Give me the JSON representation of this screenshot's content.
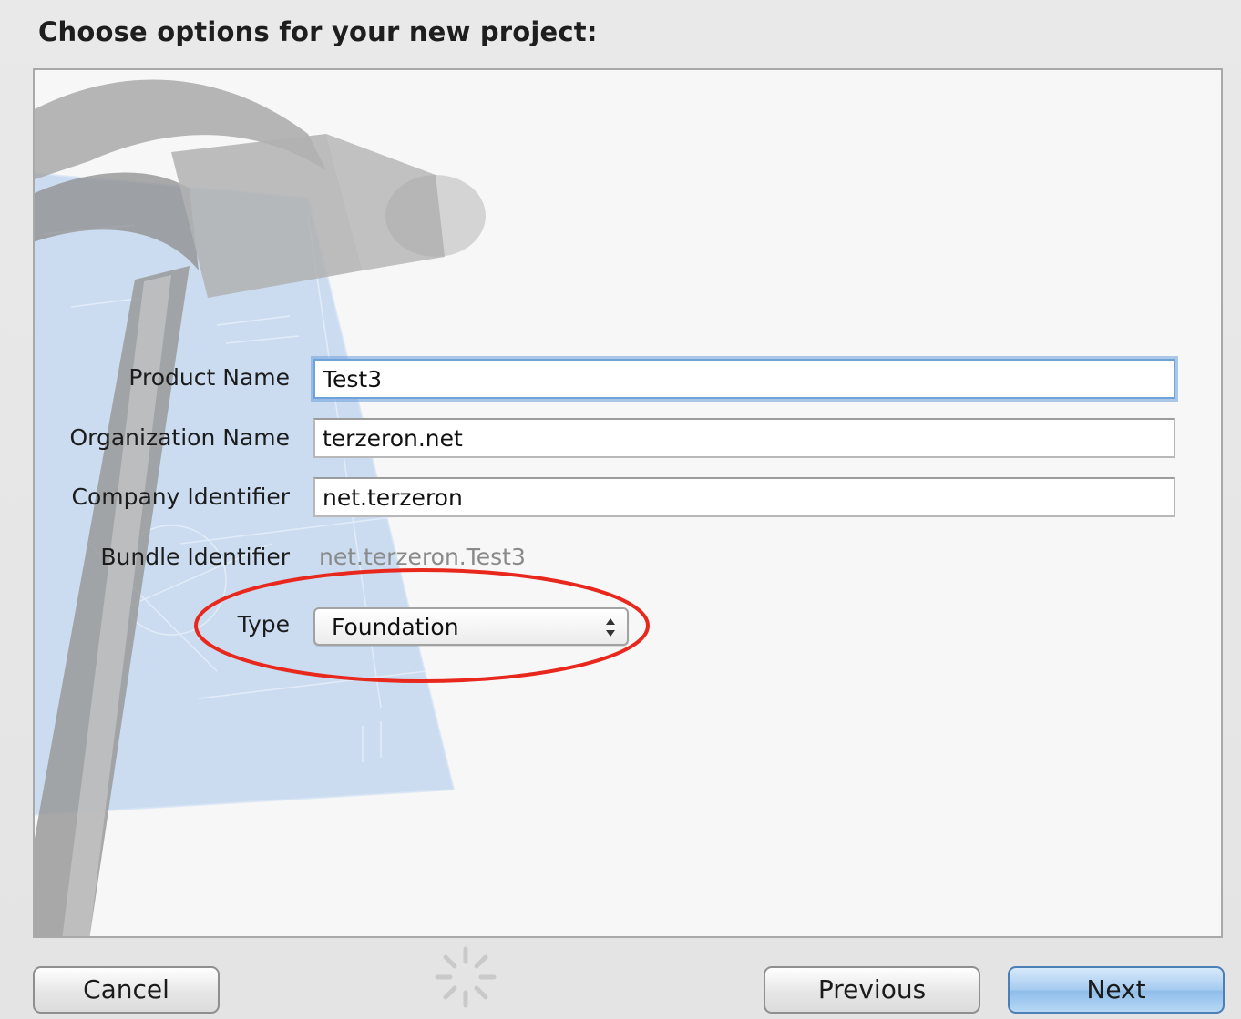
{
  "dialog": {
    "heading": "Choose options for your new project:"
  },
  "form": {
    "product_name": {
      "label": "Product Name",
      "value": "Test3"
    },
    "organization_name": {
      "label": "Organization Name",
      "value": "terzeron.net"
    },
    "company_identifier": {
      "label": "Company Identifier",
      "value": "net.terzeron"
    },
    "bundle_identifier": {
      "label": "Bundle Identifier",
      "value": "net.terzeron.Test3"
    },
    "type": {
      "label": "Type",
      "selected": "Foundation",
      "icon": "updown-chevron-icon"
    }
  },
  "buttons": {
    "cancel": "Cancel",
    "previous": "Previous",
    "next": "Next"
  },
  "colors": {
    "annotation": "#e8281c",
    "default_button": "#a6cbef",
    "focus_ring": "#6fa2d9"
  }
}
